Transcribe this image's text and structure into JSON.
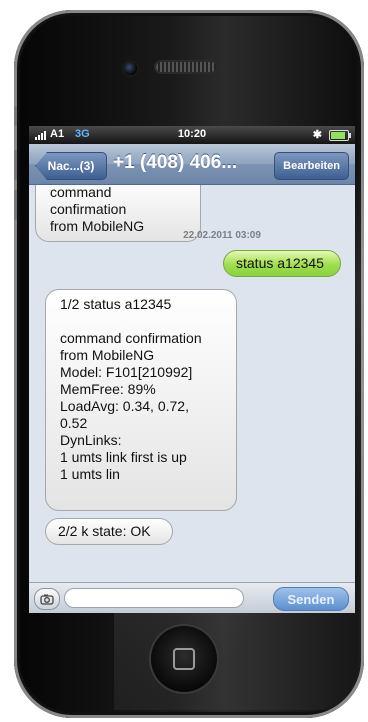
{
  "status_bar": {
    "carrier": "A1",
    "network": "3G",
    "time": "10:20",
    "bluetooth_icon": "bluetooth-icon",
    "battery_icon": "battery-icon"
  },
  "nav": {
    "back_label": "Nac...(3)",
    "title": "+1 (408) 406...",
    "edit_label": "Bearbeiten"
  },
  "messages": [
    {
      "direction": "incoming",
      "lines": [
        "command confirmation",
        "from MobileNG"
      ]
    },
    {
      "direction": "outgoing",
      "lines": [
        "status a12345"
      ]
    },
    {
      "direction": "incoming",
      "lines": [
        "1/2 status a12345",
        "",
        "command confirmation",
        "from MobileNG",
        "Model: F101[210992]",
        "MemFree: 89%",
        "LoadAvg:  0.34, 0.72,",
        "0.52",
        "DynLinks:",
        "1 umts link first is up",
        "1 umts lin"
      ]
    },
    {
      "direction": "incoming",
      "lines": [
        "2/2 k state: OK"
      ]
    }
  ],
  "timestamp": "22.02.2011 03:09",
  "compose": {
    "placeholder": "",
    "send_label": "Senden",
    "camera_icon": "camera-icon"
  },
  "colors": {
    "nav_bar": "#7c93b2",
    "outgoing_bubble": "#9fde4e",
    "incoming_bubble": "#f2f2f2",
    "network_label": "#5bb6ff",
    "send_button": "#5c8fd0"
  }
}
